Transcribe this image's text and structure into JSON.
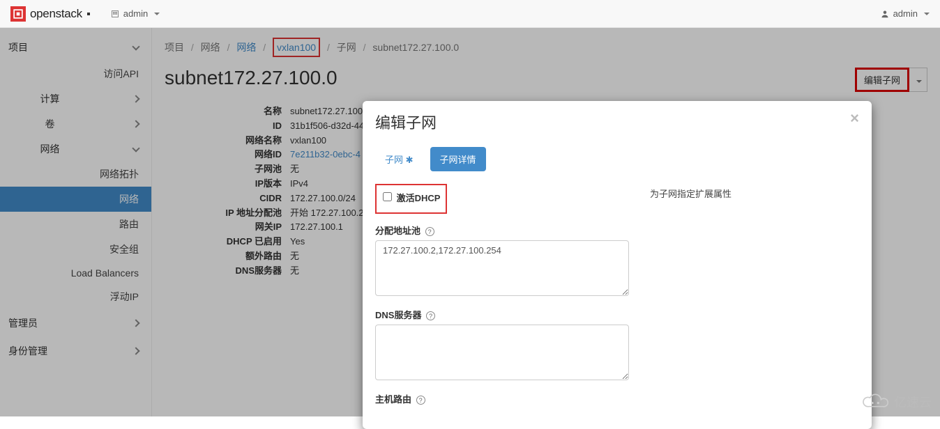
{
  "topbar": {
    "brand": "openstack",
    "project_label": "admin",
    "user_label": "admin"
  },
  "sidebar": {
    "group_project": "项目",
    "api": "访问API",
    "compute": "计算",
    "volumes": "卷",
    "network_group": "网络",
    "topology": "网络拓扑",
    "network": "网络",
    "router": "路由",
    "security": "安全组",
    "lb": "Load Balancers",
    "floating": "浮动IP",
    "admin_group": "管理员",
    "identity_group": "身份管理"
  },
  "breadcrumb": {
    "b1": "项目",
    "b2": "网络",
    "b3": "网络",
    "b4": "vxlan100",
    "b5": "子网",
    "b6": "subnet172.27.100.0"
  },
  "page": {
    "title": "subnet172.27.100.0",
    "edit_btn": "编辑子网"
  },
  "details": {
    "name_l": "名称",
    "name_v": "subnet172.27.100",
    "id_l": "ID",
    "id_v": "31b1f506-d32d-44",
    "netname_l": "网络名称",
    "netname_v": "vxlan100",
    "netid_l": "网络ID",
    "netid_v": "7e211b32-0ebc-4",
    "pool_l": "子网池",
    "pool_v": "无",
    "ipver_l": "IP版本",
    "ipver_v": "IPv4",
    "cidr_l": "CIDR",
    "cidr_v": "172.27.100.0/24",
    "alloc_l": "IP 地址分配池",
    "alloc_v": "开始 172.27.100.2",
    "gw_l": "网关IP",
    "gw_v": "172.27.100.1",
    "dhcp_l": "DHCP 已启用",
    "dhcp_v": "Yes",
    "extra_l": "额外路由",
    "extra_v": "无",
    "dns_l": "DNS服务器",
    "dns_v": "无"
  },
  "modal": {
    "title": "编辑子网",
    "tab1": "子网",
    "tab2": "子网详情",
    "dhcp_check": "激活DHCP",
    "alloc_label": "分配地址池",
    "alloc_value": "172.27.100.2,172.27.100.254",
    "dns_label": "DNS服务器",
    "hostroute_label": "主机路由",
    "hint": "为子网指定扩展属性"
  },
  "watermark": "亿速云"
}
